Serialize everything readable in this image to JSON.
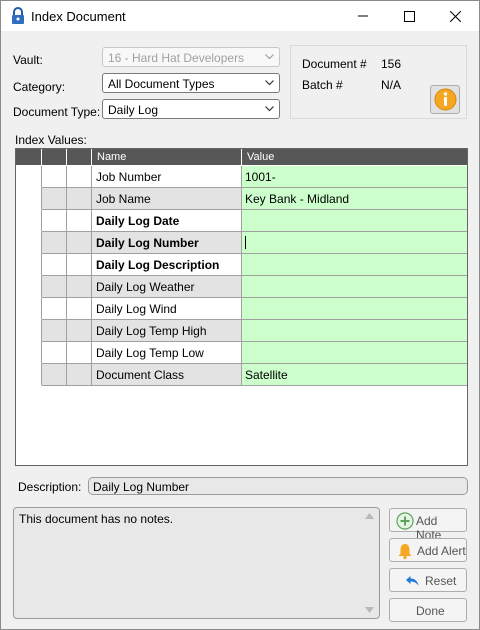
{
  "window": {
    "title": "Index Document"
  },
  "form": {
    "vault_label": "Vault:",
    "vault_value": "16 - Hard Hat Developers",
    "category_label": "Category:",
    "category_value": "All Document Types",
    "doctype_label": "Document Type:",
    "doctype_value": "Daily Log",
    "document_number_label": "Document #",
    "document_number_value": "156",
    "batch_label": "Batch #",
    "batch_value": "N/A"
  },
  "index": {
    "label": "Index Values:",
    "columns": {
      "name": "Name",
      "value": "Value"
    },
    "rows": [
      {
        "name": "Job Number",
        "value": "1001-",
        "bold": false,
        "shaded": false
      },
      {
        "name": "Job Name",
        "value": "Key Bank - Midland",
        "bold": false,
        "shaded": true
      },
      {
        "name": "Daily Log Date",
        "value": "",
        "bold": true,
        "shaded": false
      },
      {
        "name": "Daily Log Number",
        "value": "",
        "bold": true,
        "shaded": true,
        "cursor": true
      },
      {
        "name": "Daily Log Description",
        "value": "",
        "bold": true,
        "shaded": false
      },
      {
        "name": "Daily Log Weather",
        "value": "",
        "bold": false,
        "shaded": true
      },
      {
        "name": "Daily Log Wind",
        "value": "",
        "bold": false,
        "shaded": false
      },
      {
        "name": "Daily Log Temp High",
        "value": "",
        "bold": false,
        "shaded": true
      },
      {
        "name": "Daily Log Temp Low",
        "value": "",
        "bold": false,
        "shaded": false
      },
      {
        "name": "Document Class",
        "value": "Satellite",
        "bold": false,
        "shaded": true
      }
    ]
  },
  "description": {
    "label": "Description:",
    "value": "Daily Log Number"
  },
  "notes": {
    "text": "This document has no notes."
  },
  "buttons": {
    "add_note": "Add Note",
    "add_alert": "Add Alert",
    "reset": "Reset",
    "done": "Done"
  },
  "colors": {
    "value_bg": "#ccffcc",
    "header_bg": "#575757",
    "shaded_bg": "#e3e3e3",
    "info": "#f5a623"
  }
}
